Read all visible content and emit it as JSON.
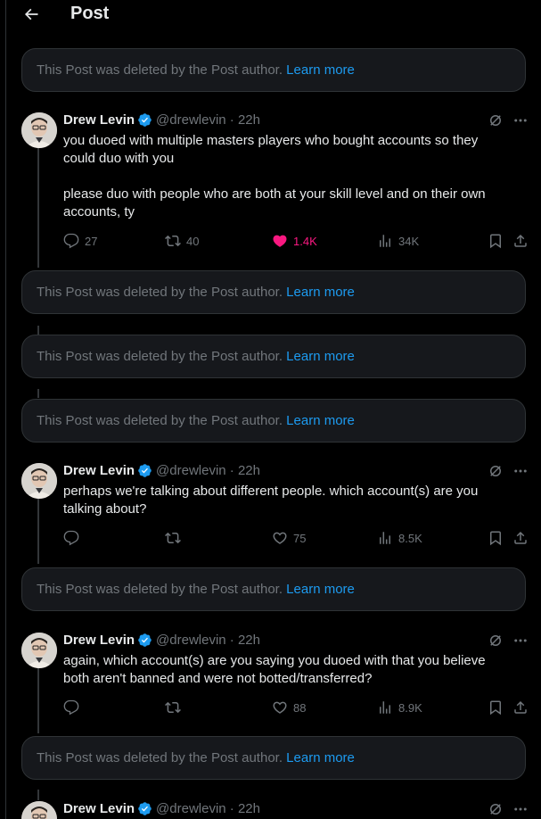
{
  "header": {
    "title": "Post"
  },
  "deleted_notice": {
    "text": "This Post was deleted by the Post author.",
    "link": "Learn more"
  },
  "tweets": [
    {
      "name": "Drew Levin",
      "handle": "@drewlevin",
      "time": "· 22h",
      "paragraphs": [
        "you duoed with multiple masters players who bought accounts so they could duo with you",
        "please duo with people who are both at your skill level and on their own accounts, ty"
      ],
      "replies": "27",
      "reposts": "40",
      "likes": "1.4K",
      "views": "34K",
      "liked": true
    },
    {
      "name": "Drew Levin",
      "handle": "@drewlevin",
      "time": "· 22h",
      "paragraphs": [
        "perhaps we're talking about different people. which account(s) are you talking about?"
      ],
      "replies": "",
      "reposts": "",
      "likes": "75",
      "views": "8.5K",
      "liked": false
    },
    {
      "name": "Drew Levin",
      "handle": "@drewlevin",
      "time": "· 22h",
      "paragraphs": [
        "again, which account(s) are you saying you duoed with that you believe both aren't banned and were not botted/transferred?"
      ],
      "replies": "",
      "reposts": "",
      "likes": "88",
      "views": "8.9K",
      "liked": false
    },
    {
      "name": "Drew Levin",
      "handle": "@drewlevin",
      "time": "· 22h"
    }
  ],
  "colors": {
    "accent": "#1d9bf0",
    "like": "#f91880",
    "muted": "#71767b",
    "card": "#16181c",
    "border": "#2f3336"
  },
  "icons": [
    "back-arrow-icon",
    "verified-badge-icon",
    "grok-icon",
    "more-icon",
    "reply-icon",
    "repost-icon",
    "like-icon",
    "views-icon",
    "bookmark-icon",
    "share-icon"
  ]
}
